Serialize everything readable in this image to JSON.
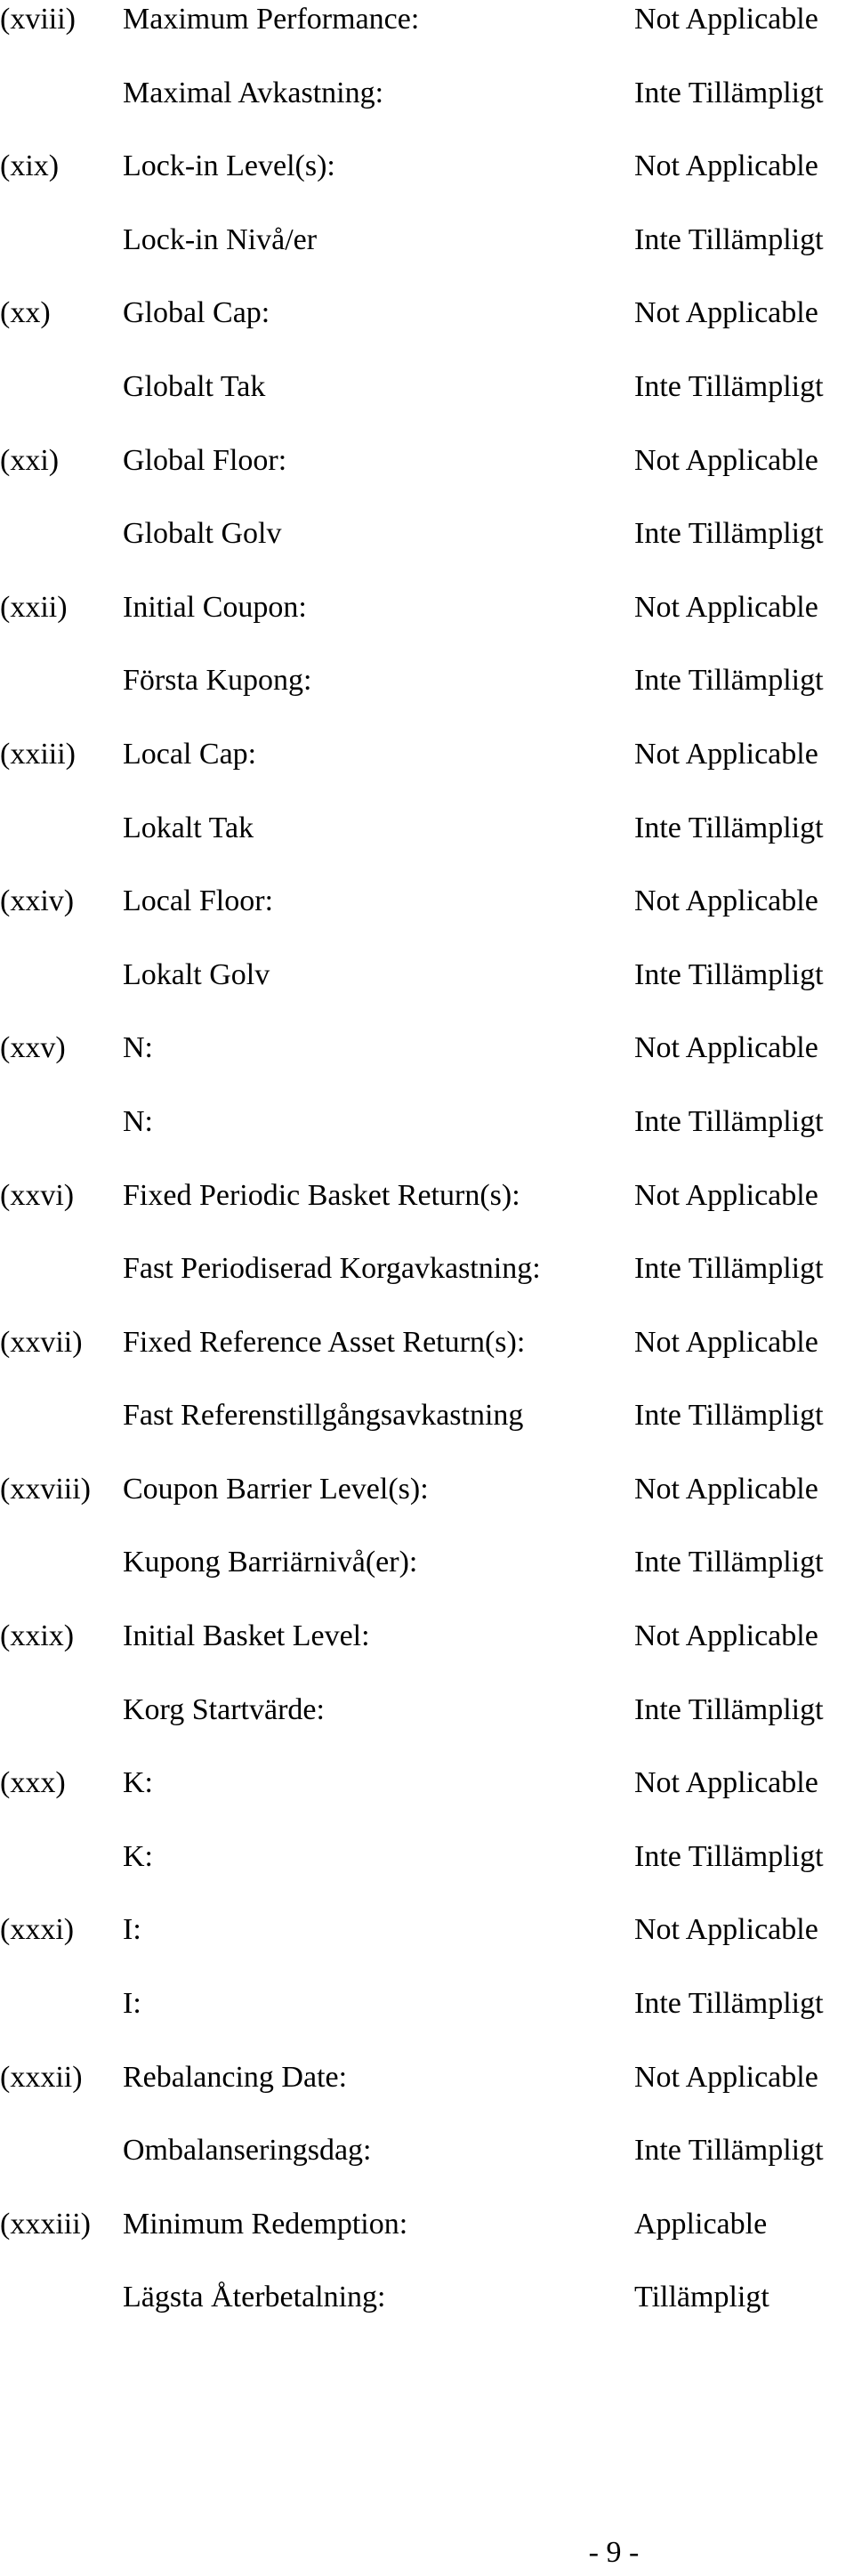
{
  "items": [
    {
      "num": "(xviii)",
      "label_en": "Maximum Performance:",
      "value_en": "Not Applicable",
      "label_sv": "Maximal Avkastning:",
      "value_sv": "Inte Tillämpligt"
    },
    {
      "num": "(xix)",
      "label_en": "Lock-in Level(s):",
      "value_en": "Not Applicable",
      "label_sv": "Lock-in Nivå/er",
      "value_sv": "Inte Tillämpligt"
    },
    {
      "num": "(xx)",
      "label_en": "Global Cap:",
      "value_en": "Not Applicable",
      "label_sv": "Globalt Tak",
      "value_sv": "Inte Tillämpligt"
    },
    {
      "num": "(xxi)",
      "label_en": "Global Floor:",
      "value_en": "Not Applicable",
      "label_sv": "Globalt Golv",
      "value_sv": "Inte Tillämpligt"
    },
    {
      "num": "(xxii)",
      "label_en": "Initial Coupon:",
      "value_en": "Not Applicable",
      "label_sv": "Första Kupong:",
      "value_sv": "Inte Tillämpligt"
    },
    {
      "num": "(xxiii)",
      "label_en": "Local Cap:",
      "value_en": "Not Applicable",
      "label_sv": "Lokalt Tak",
      "value_sv": "Inte Tillämpligt"
    },
    {
      "num": "(xxiv)",
      "label_en": "Local Floor:",
      "value_en": "Not Applicable",
      "label_sv": "Lokalt Golv",
      "value_sv": "Inte Tillämpligt"
    },
    {
      "num": "(xxv)",
      "label_en": "N:",
      "value_en": "Not Applicable",
      "label_sv": "N:",
      "value_sv": "Inte Tillämpligt"
    },
    {
      "num": "(xxvi)",
      "label_en": "Fixed Periodic Basket Return(s):",
      "value_en": "Not Applicable",
      "label_sv": "Fast Periodiserad Korgavkastning:",
      "value_sv": "Inte Tillämpligt"
    },
    {
      "num": "(xxvii)",
      "label_en": "Fixed Reference Asset Return(s):",
      "value_en": "Not Applicable",
      "label_sv": "Fast Referenstillgångsavkastning",
      "value_sv": "Inte Tillämpligt"
    },
    {
      "num": "(xxviii)",
      "label_en": "Coupon Barrier Level(s):",
      "value_en": "Not Applicable",
      "label_sv": "Kupong Barriärnivå(er):",
      "value_sv": "Inte Tillämpligt"
    },
    {
      "num": "(xxix)",
      "label_en": "Initial Basket Level:",
      "value_en": "Not Applicable",
      "label_sv": "Korg Startvärde:",
      "value_sv": "Inte Tillämpligt"
    },
    {
      "num": "(xxx)",
      "label_en": "K:",
      "value_en": "Not Applicable",
      "label_sv": "K:",
      "value_sv": "Inte Tillämpligt"
    },
    {
      "num": "(xxxi)",
      "label_en": "I:",
      "value_en": "Not Applicable",
      "label_sv": "I:",
      "value_sv": "Inte Tillämpligt"
    },
    {
      "num": "(xxxii)",
      "label_en": "Rebalancing Date:",
      "value_en": "Not Applicable",
      "label_sv": "Ombalanseringsdag:",
      "value_sv": "Inte Tillämpligt"
    },
    {
      "num": "(xxxiii)",
      "label_en": "Minimum Redemption:",
      "value_en": "Applicable",
      "label_sv": "Lägsta Återbetalning:",
      "value_sv": "Tillämpligt"
    }
  ],
  "page_number": "- 9 -"
}
